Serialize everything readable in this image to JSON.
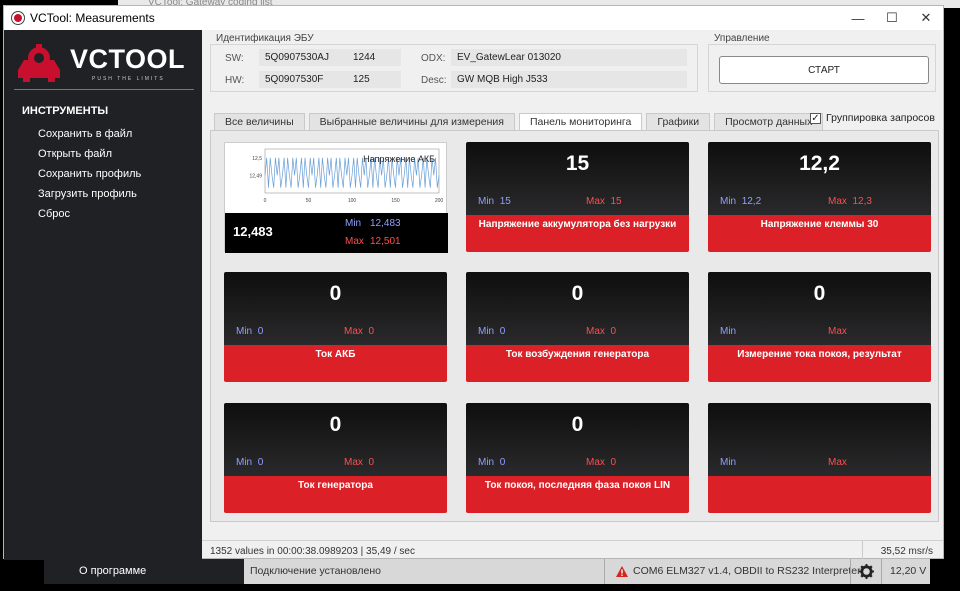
{
  "window": {
    "background_title": "VCTool: Gateway coding list",
    "title": "VCTool: Measurements",
    "controls": [
      "—",
      "☐",
      "✕"
    ]
  },
  "sidebar": {
    "brand": "VCTOOL",
    "tagline": "PUSH THE LIMITS",
    "section": "ИНСТРУМЕНТЫ",
    "items": [
      "Сохранить в файл",
      "Открыть файл",
      "Сохранить профиль",
      "Загрузить профиль",
      "Сброс"
    ],
    "about": "О программе"
  },
  "ecu": {
    "group_title": "Идентификация ЭБУ",
    "sw_label": "SW:",
    "sw": "5Q0907530AJ",
    "sw_code": "1244",
    "hw_label": "HW:",
    "hw": "5Q0907530F",
    "hw_code": "125",
    "odx_label": "ODX:",
    "odx": "EV_GatewLear 013020",
    "desc_label": "Desc:",
    "desc": "GW MQB High   J533"
  },
  "control": {
    "group_title": "Управление",
    "start_label": "СТАРТ"
  },
  "tabs": [
    {
      "label": "Все величины",
      "active": false
    },
    {
      "label": "Выбранные величины для измерения",
      "active": false
    },
    {
      "label": "Панель мониторинга",
      "active": true
    },
    {
      "label": "Графики",
      "active": false
    },
    {
      "label": "Просмотр данных",
      "active": false
    }
  ],
  "grouping": {
    "label": "Группировка запросов",
    "checked": true,
    "mark": "✓"
  },
  "chart_tile": {
    "value": "12,483",
    "min_label": "Min",
    "min": "12,483",
    "max_label": "Max",
    "max": "12,501",
    "chart_data": {
      "type": "line",
      "title": "Напряжение АКБ",
      "x": [
        0,
        2,
        4,
        6,
        8,
        10,
        12,
        14,
        16,
        18,
        20,
        22,
        24,
        26,
        28,
        30,
        32,
        34,
        36,
        38,
        40,
        42,
        44,
        46,
        48,
        50,
        52,
        54,
        56,
        58,
        60,
        62,
        64,
        66,
        68,
        70,
        72,
        74,
        76,
        78,
        80,
        82,
        84,
        86,
        88,
        90,
        92,
        94,
        96,
        98,
        100,
        102,
        104,
        106,
        108,
        110,
        112,
        114,
        116,
        118,
        120,
        122,
        124,
        126,
        128,
        130,
        132,
        134,
        136,
        138,
        140,
        142,
        144,
        146,
        148,
        150,
        152,
        154,
        156,
        158,
        160,
        162,
        164,
        166,
        168,
        170,
        172,
        174,
        176,
        178,
        180,
        182,
        184,
        186,
        188,
        190,
        192,
        194,
        196,
        198,
        200
      ],
      "y": [
        12.49,
        12.5,
        12.483,
        12.5,
        12.49,
        12.483,
        12.5,
        12.49,
        12.5,
        12.483,
        12.49,
        12.5,
        12.483,
        12.5,
        12.49,
        12.483,
        12.5,
        12.49,
        12.5,
        12.483,
        12.49,
        12.5,
        12.483,
        12.5,
        12.49,
        12.483,
        12.5,
        12.49,
        12.5,
        12.483,
        12.49,
        12.5,
        12.483,
        12.5,
        12.49,
        12.483,
        12.5,
        12.49,
        12.5,
        12.483,
        12.49,
        12.5,
        12.483,
        12.5,
        12.49,
        12.483,
        12.5,
        12.49,
        12.5,
        12.483,
        12.49,
        12.5,
        12.483,
        12.5,
        12.49,
        12.483,
        12.5,
        12.49,
        12.5,
        12.483,
        12.49,
        12.5,
        12.483,
        12.5,
        12.49,
        12.483,
        12.5,
        12.49,
        12.5,
        12.483,
        12.49,
        12.5,
        12.483,
        12.5,
        12.49,
        12.483,
        12.5,
        12.49,
        12.5,
        12.483,
        12.49,
        12.5,
        12.483,
        12.5,
        12.49,
        12.483,
        12.5,
        12.49,
        12.5,
        12.483,
        12.49,
        12.5,
        12.483,
        12.5,
        12.49,
        12.483,
        12.5,
        12.49,
        12.5,
        12.483,
        12.49
      ],
      "xlim": [
        0,
        200
      ],
      "ylim": [
        12.48,
        12.505
      ],
      "x_ticks": [
        "0",
        "50",
        "100",
        "150",
        "200"
      ],
      "y_ticks": [
        "12,5",
        "12,49"
      ],
      "color": "#6a9fd8"
    }
  },
  "tiles": [
    {
      "value": "15",
      "min_label": "Min",
      "min": "15",
      "max_label": "Max",
      "max": "15",
      "name": "Напряжение аккумулятора без нагрузки"
    },
    {
      "value": "12,2",
      "min_label": "Min",
      "min": "12,2",
      "max_label": "Max",
      "max": "12,3",
      "name": "Напряжение клеммы 30"
    },
    {
      "value": "0",
      "min_label": "Min",
      "min": "0",
      "max_label": "Max",
      "max": "0",
      "name": "Ток АКБ"
    },
    {
      "value": "0",
      "min_label": "Min",
      "min": "0",
      "max_label": "Max",
      "max": "0",
      "name": "Ток возбуждения генератора"
    },
    {
      "value": "0",
      "min_label": "Min",
      "min": "",
      "max_label": "Max",
      "max": "",
      "name": "Измерение тока покоя, результат"
    },
    {
      "value": "0",
      "min_label": "Min",
      "min": "0",
      "max_label": "Max",
      "max": "0",
      "name": "Ток генератора"
    },
    {
      "value": "0",
      "min_label": "Min",
      "min": "0",
      "max_label": "Max",
      "max": "0",
      "name": "Ток покоя, последняя фаза покоя LIN"
    },
    {
      "value": "",
      "min_label": "Min",
      "min": "",
      "max_label": "Max",
      "max": "",
      "name": ""
    }
  ],
  "status": {
    "left": "1352 values in 00:00:38.0989203 | 35,49 / sec",
    "right": "35,52 msr/s"
  },
  "connection": {
    "state": "Подключение установлено",
    "interface": "COM6 ELM327 v1.4, OBDII to RS232 Interpreter",
    "voltage": "12,20 V"
  },
  "colors": {
    "accent_red": "#db2127",
    "sidebar": "#202124",
    "min_color": "#8ea0ff",
    "max_color": "#ff4d4d"
  }
}
